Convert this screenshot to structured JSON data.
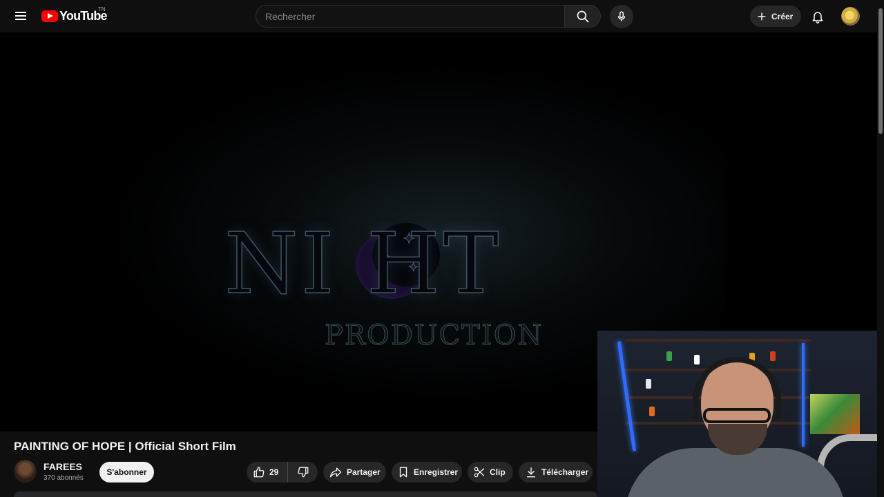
{
  "masthead": {
    "logo_text": "YouTube",
    "region_code": "TN",
    "search_placeholder": "Rechercher",
    "create_label": "Créer"
  },
  "player": {
    "logo_word": "NI HT",
    "logo_sub": "PRODUCTION"
  },
  "video": {
    "title": "PAINTING OF HOPE | Official Short Film"
  },
  "channel": {
    "name": "FAREES",
    "subscribers": "370 abonnés",
    "subscribe_label": "S'abonner"
  },
  "actions": {
    "like_count": "29",
    "share_label": "Partager",
    "save_label": "Enregistrer",
    "clip_label": "Clip",
    "download_label": "Télécharger"
  },
  "colors": {
    "background": "#0f0f0f",
    "brand_red": "#ff0000",
    "pill_bg": "#272727",
    "subscribe_bg": "#f1f1f1"
  },
  "icons": [
    "menu-icon",
    "youtube-logo-icon",
    "search-icon",
    "mic-icon",
    "plus-icon",
    "bell-icon",
    "like-icon",
    "dislike-icon",
    "share-icon",
    "save-icon",
    "scissors-icon",
    "download-icon"
  ]
}
